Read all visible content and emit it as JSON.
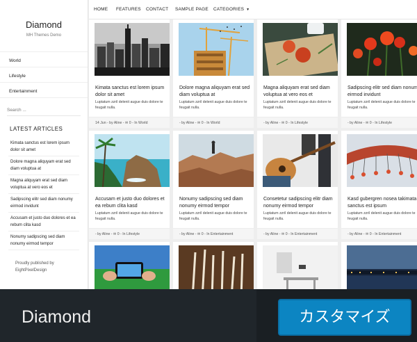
{
  "site": {
    "title": "Diamond",
    "tagline": "MH Themes Demo"
  },
  "sidebar": {
    "menu": [
      "World",
      "Lifestyle",
      "Entertainment"
    ],
    "search_placeholder": "Search ...",
    "latest_title": "LATEST ARTICLES",
    "latest": [
      "Kimata sanctus est lorem ipsum dolor sit amet",
      "Dolore magna aliquyam erat sed diam voluptua at",
      "Magna aliquyam erat sed diam voluptua at vero eos et",
      "Sadipscing elitr sed diam nonumy eirmod invidunt",
      "Accusam et justo duo dolores et ea rebum clita kasd",
      "Nonumy sadipscing sed diam nonumy eirmod tempor"
    ],
    "powered": [
      "Proudly published by",
      "EightPixelDesign"
    ]
  },
  "nav": {
    "items": [
      "HOME",
      "FEATURES",
      "CONTACT",
      "SAMPLE PAGE",
      "CATEGORIES"
    ],
    "caret": "▼"
  },
  "excerpt": "Luptatum zzril delenit augue duis dolore te feugait nulla.",
  "posts": [
    {
      "title": "Kimata sanctus est lorem ipsum dolor sit amet",
      "meta": "14 Jun - by Aline - ✉ 0 - In World"
    },
    {
      "title": "Dolore magna aliquyam erat sed diam voluptua at",
      "meta": "- by Aline - ✉ 0 - In World"
    },
    {
      "title": "Magna aliquyam erat sed diam voluptua at vero eos et",
      "meta": "- by Aline - ✉ 0 - In Lifestyle"
    },
    {
      "title": "Sadipscing elitr sed diam nonumy eirmod invidunt",
      "meta": "- by Aline - ✉ 0 - In Lifestyle"
    },
    {
      "title": "Accusam et justo duo dolores et ea rebum clita kasd",
      "meta": "- by Aline - ✉ 0 - In Lifestyle"
    },
    {
      "title": "Nonumy sadipscing sed diam nonumy eirmod tempor",
      "meta": "- by Aline - ✉ 0 - In Entertainment"
    },
    {
      "title": "Consetetur sadipscing elitr diam nonumy eirmod tempor",
      "meta": "- by Aline - ✉ 0 - In Entertainment"
    },
    {
      "title": "Kasd gubergren nosea takimata sanctus est ipsum",
      "meta": "- by Aline - ✉ 0 - In Entertainment"
    }
  ],
  "bottom": {
    "theme_name": "Diamond",
    "customize_label": "カスタマイズ"
  },
  "colors": {
    "accent": "#0c85c2",
    "bar": "#20262b"
  }
}
